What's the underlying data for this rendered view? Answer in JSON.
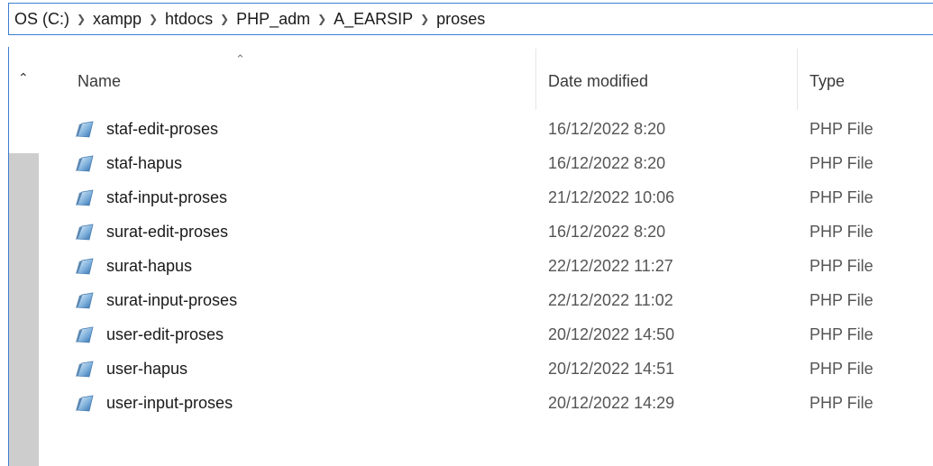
{
  "breadcrumb": [
    {
      "label": "OS (C:)"
    },
    {
      "label": "xampp"
    },
    {
      "label": "htdocs"
    },
    {
      "label": "PHP_adm"
    },
    {
      "label": "A_EARSIP"
    },
    {
      "label": "proses"
    }
  ],
  "columns": {
    "name": "Name",
    "date": "Date modified",
    "type": "Type"
  },
  "files": [
    {
      "name": "staf-edit-proses",
      "date": "16/12/2022 8:20",
      "type": "PHP File"
    },
    {
      "name": "staf-hapus",
      "date": "16/12/2022 8:20",
      "type": "PHP File"
    },
    {
      "name": "staf-input-proses",
      "date": "21/12/2022 10:06",
      "type": "PHP File"
    },
    {
      "name": "surat-edit-proses",
      "date": "16/12/2022 8:20",
      "type": "PHP File"
    },
    {
      "name": "surat-hapus",
      "date": "22/12/2022 11:27",
      "type": "PHP File"
    },
    {
      "name": "surat-input-proses",
      "date": "22/12/2022 11:02",
      "type": "PHP File"
    },
    {
      "name": "user-edit-proses",
      "date": "20/12/2022 14:50",
      "type": "PHP File"
    },
    {
      "name": "user-hapus",
      "date": "20/12/2022 14:51",
      "type": "PHP File"
    },
    {
      "name": "user-input-proses",
      "date": "20/12/2022 14:29",
      "type": "PHP File"
    }
  ],
  "icons": {
    "breadcrumb_separator": "chevron-right-icon",
    "scroll_up": "chevron-up-icon",
    "sort": "sort-ascending-icon",
    "file": "php-file-icon"
  },
  "colors": {
    "accent": "#3c7fd1",
    "scrollbar": "#cdcdcd"
  }
}
